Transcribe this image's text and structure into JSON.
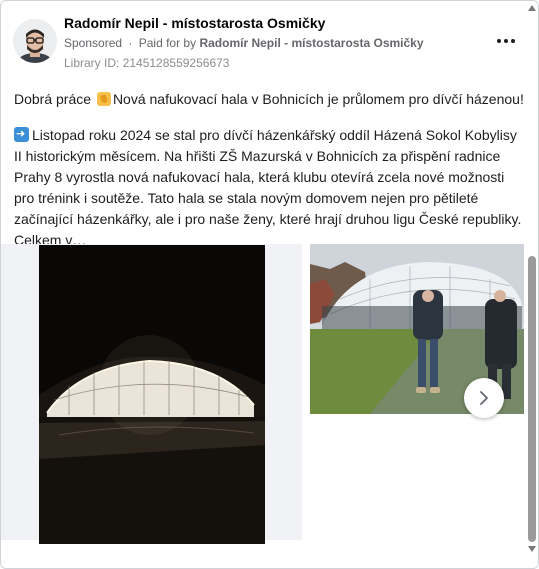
{
  "header": {
    "page_name": "Radomír Nepil - místostarosta Osmičky",
    "sponsored": "Sponsored",
    "dot": "·",
    "paid_for_prefix": "Paid for by",
    "paid_for_name": "Radomír Nepil - místostarosta Osmičky",
    "library_id": "Library ID: 2145128559256673",
    "more_icon": "more-horizontal-icon"
  },
  "post": {
    "line1_start": "Dobrá práce",
    "line1_end": "Nová nafukovací hala v Bohnicích je průlomem pro dívčí házenou!",
    "paragraph": "Listopad roku 2024 se stal pro dívčí házenkářský oddíl Házená Sokol Kobylisy II historickým měsícem. Na hřišti ZŠ Mazurská v Bohnicích za přispění radnice Prahy 8 vyrostla nová nafukovací hala, která klubu otevírá zcela nové možnosti pro trénink i soutěže. Tato hala se stala novým domovem nejen pro pětileté začínající házenkářky, ale i pro naše ženy, které hrají druhou ligu České republiky. Celkem v…"
  },
  "icons": {
    "clap": "clapping-hands-emoji-icon",
    "arrow": "right-arrow-emoji-icon",
    "next": "chevron-right-icon"
  },
  "colors": {
    "secondary_text": "#65676b",
    "primary_text": "#050505",
    "card_border": "#cfd2d6"
  }
}
